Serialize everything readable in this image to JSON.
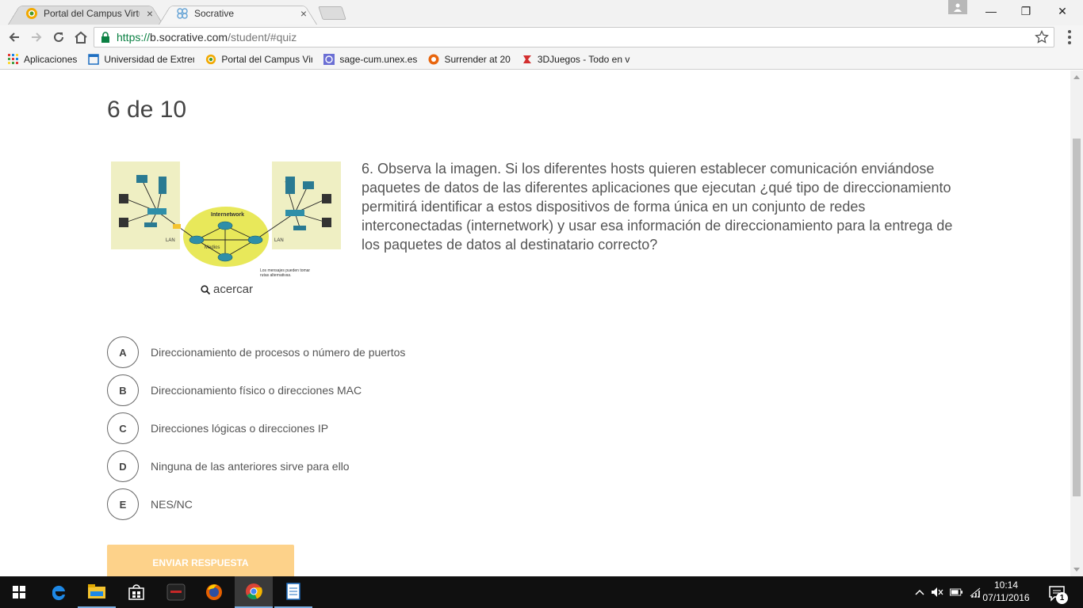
{
  "browser": {
    "tabs": [
      {
        "title": "Portal del Campus Virtual",
        "favicon": "campus-icon",
        "active": false
      },
      {
        "title": "Socrative",
        "favicon": "socrative-icon",
        "active": true
      }
    ],
    "close_glyph": "×",
    "url": {
      "scheme": "https://",
      "host": "b.socrative.com",
      "path": "/student/#quiz"
    },
    "bookmarks": [
      {
        "label": "Aplicaciones",
        "icon": "apps-grid-icon"
      },
      {
        "label": "Universidad de Extrem",
        "icon": "page-icon"
      },
      {
        "label": "Portal del Campus Vir",
        "icon": "campus-icon"
      },
      {
        "label": "sage-cum.unex.es",
        "icon": "sage-icon"
      },
      {
        "label": "Surrender at 20",
        "icon": "surrender-icon"
      },
      {
        "label": "3DJuegos - Todo en v",
        "icon": "3djuegos-icon"
      }
    ],
    "window_controls": {
      "minimize": "—",
      "maximize": "❐",
      "close": "✕"
    }
  },
  "quiz": {
    "progress": "6 de 10",
    "question": "6. Observa la imagen. Si los diferentes hosts quieren establecer comunicación enviándose paquetes de datos de las diferentes aplicaciones que ejecutan ¿qué tipo de direccionamiento permitirá identificar a estos dispositivos de forma única en un conjunto de redes interconectadas (internetwork) y usar esa información de direccionamiento para la entrega de los paquetes de datos al destinatario correcto?",
    "figure": {
      "internetwork_label": "Internetwork",
      "media_label": "Medios",
      "lan_left_label": "LAN",
      "lan_right_label": "LAN",
      "caption_line1": "Los mensajes pueden tomar",
      "caption_line2": "rutas alternativas."
    },
    "zoom_label": "acercar",
    "answers": [
      {
        "letter": "A",
        "text": "Direccionamiento de procesos o número de puertos"
      },
      {
        "letter": "B",
        "text": "Direccionamiento físico o direcciones MAC"
      },
      {
        "letter": "C",
        "text": "Direcciones lógicas o direcciones IP"
      },
      {
        "letter": "D",
        "text": "Ninguna de las anteriores sirve para ello"
      },
      {
        "letter": "E",
        "text": "NES/NC"
      }
    ],
    "submit_label": "ENVIAR RESPUESTA",
    "submit_color": "#fdd28a"
  },
  "taskbar": {
    "items": [
      "start-icon",
      "edge-icon",
      "file-explorer-icon",
      "store-icon",
      "asus-icon",
      "firefox-icon",
      "chrome-icon",
      "document-icon"
    ],
    "clock_time": "10:14",
    "clock_date": "07/11/2016",
    "notification_count": "1"
  }
}
